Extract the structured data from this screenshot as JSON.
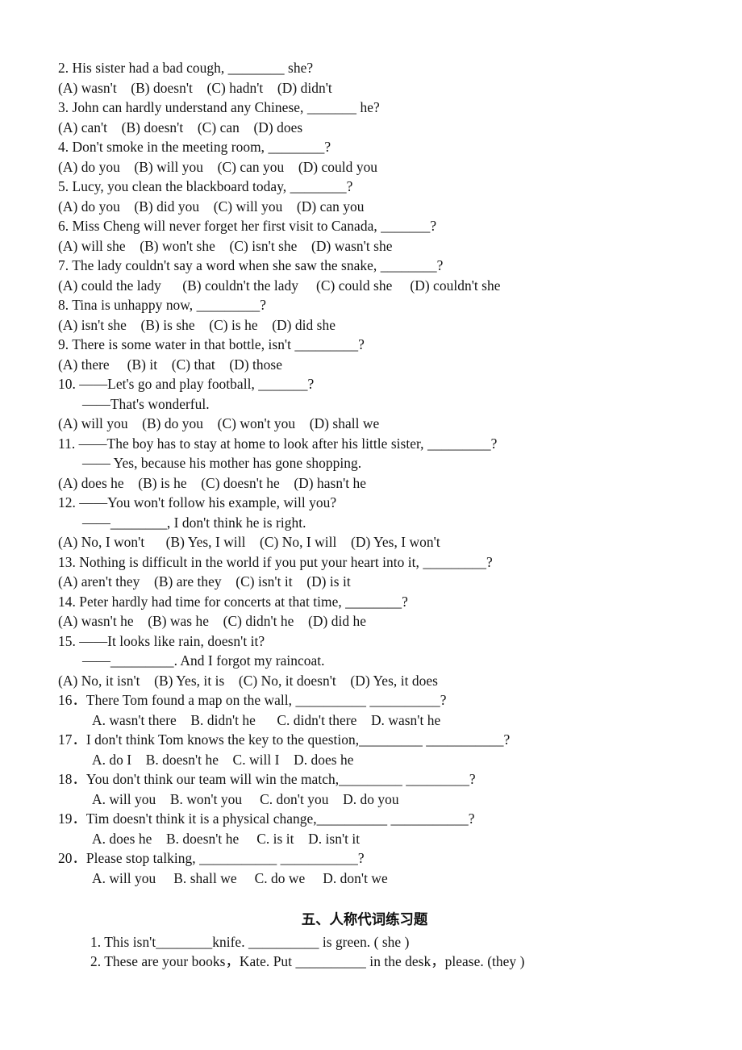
{
  "document": {
    "background_color": "#ffffff",
    "text_color": "#141414",
    "lines": [
      {
        "id": "q2-stem",
        "text": "2. His sister had a bad cough, ________ she?"
      },
      {
        "id": "q2-options",
        "text": "(A) wasn't    (B) doesn't    (C) hadn't    (D) didn't"
      },
      {
        "id": "q3-stem",
        "text": "3. John can hardly understand any Chinese, _______ he?"
      },
      {
        "id": "q3-options",
        "text": "(A) can't    (B) doesn't    (C) can    (D) does"
      },
      {
        "id": "q4-stem",
        "text": "4. Don't smoke in the meeting room, ________?"
      },
      {
        "id": "q4-options",
        "text": "(A) do you    (B) will you    (C) can you    (D) could you"
      },
      {
        "id": "q5-stem",
        "text": "5. Lucy, you clean the blackboard today, ________?"
      },
      {
        "id": "q5-options",
        "text": "(A) do you    (B) did you    (C) will you    (D) can you"
      },
      {
        "id": "q6-stem",
        "text": "6. Miss Cheng will never forget her first visit to Canada, _______?"
      },
      {
        "id": "q6-options",
        "text": "(A) will she    (B) won't she    (C) isn't she    (D) wasn't she"
      },
      {
        "id": "q7-stem",
        "text": "7. The lady couldn't say a word when she saw the snake, ________?"
      },
      {
        "id": "q7-options",
        "text": "(A) could the lady      (B) couldn't the lady     (C) could she     (D) couldn't she"
      },
      {
        "id": "q8-stem",
        "text": "8. Tina is unhappy now, _________?"
      },
      {
        "id": "q8-options",
        "text": "(A) isn't she    (B) is she    (C) is he    (D) did she"
      },
      {
        "id": "q9-stem",
        "text": "9. There is some water in that bottle, isn't _________?"
      },
      {
        "id": "q9-options",
        "text": "(A) there     (B) it    (C) that    (D) those"
      },
      {
        "id": "q10-stem",
        "text": "10. ——Let's go and play football, _______?"
      },
      {
        "id": "q10-reply",
        "text": "——That's wonderful.",
        "indent": "indent-1"
      },
      {
        "id": "q10-options",
        "text": "(A) will you    (B) do you    (C) won't you    (D) shall we"
      },
      {
        "id": "q11-stem",
        "text": "11. ——The boy has to stay at home to look after his little sister, _________?"
      },
      {
        "id": "q11-reply",
        "text": "—— Yes, because his mother has gone shopping.",
        "indent": "indent-1"
      },
      {
        "id": "q11-options",
        "text": "(A) does he    (B) is he    (C) doesn't he    (D) hasn't he"
      },
      {
        "id": "q12-stem",
        "text": "12. ——You won't follow his example, will you?"
      },
      {
        "id": "q12-reply",
        "text": "——________, I don't think he is right.",
        "indent": "indent-1"
      },
      {
        "id": "q12-options",
        "text": "(A) No, I won't      (B) Yes, I will    (C) No, I will    (D) Yes, I won't"
      },
      {
        "id": "q13-stem",
        "text": "13. Nothing is difficult in the world if you put your heart into it, _________?"
      },
      {
        "id": "q13-options",
        "text": "(A) aren't they    (B) are they    (C) isn't it    (D) is it"
      },
      {
        "id": "q14-stem",
        "text": "14. Peter hardly had time for concerts at that time, ________?"
      },
      {
        "id": "q14-options",
        "text": "(A) wasn't he    (B) was he    (C) didn't he    (D) did he"
      },
      {
        "id": "q15-stem",
        "text": "15. ——It looks like rain, doesn't it?"
      },
      {
        "id": "q15-reply",
        "text": "——_________. And I forgot my raincoat.",
        "indent": "indent-1"
      },
      {
        "id": "q15-options",
        "text": "(A) No, it isn't    (B) Yes, it is    (C) No, it doesn't    (D) Yes, it does"
      },
      {
        "id": "q16-stem",
        "text": "16．There Tom found a map on the wall, __________ __________?"
      },
      {
        "id": "q16-options",
        "text": "A. wasn't there    B. didn't he      C. didn't there    D. wasn't he",
        "indent": "indent-2"
      },
      {
        "id": "q17-stem",
        "text": "17．I don't think Tom knows the key to the question,_________ ___________?"
      },
      {
        "id": "q17-options",
        "text": "A. do I    B. doesn't he    C. will I    D. does he",
        "indent": "indent-2"
      },
      {
        "id": "q18-stem",
        "text": "18．You don't think our team will win the match,_________ _________?"
      },
      {
        "id": "q18-options",
        "text": "A. will you    B. won't you     C. don't you    D. do you",
        "indent": "indent-2"
      },
      {
        "id": "q19-stem",
        "text": "19．Tim doesn't think it is a physical change,__________ ___________?"
      },
      {
        "id": "q19-options",
        "text": "A. does he    B. doesn't he     C. is it    D. isn't it",
        "indent": "indent-2"
      },
      {
        "id": "q20-stem",
        "text": "20．Please stop talking, ___________ ___________?"
      },
      {
        "id": "q20-options",
        "text": "A. will you     B. shall we     C. do we     D. don't we",
        "indent": "indent-2"
      }
    ],
    "section_heading": "五、人称代词练习题",
    "pronoun_items": [
      {
        "id": "p1",
        "text": "1. This isn't________knife. __________ is green. ( she )"
      },
      {
        "id": "p2",
        "text": "2. These are your books，Kate. Put __________ in the desk，please. (they )"
      }
    ]
  }
}
